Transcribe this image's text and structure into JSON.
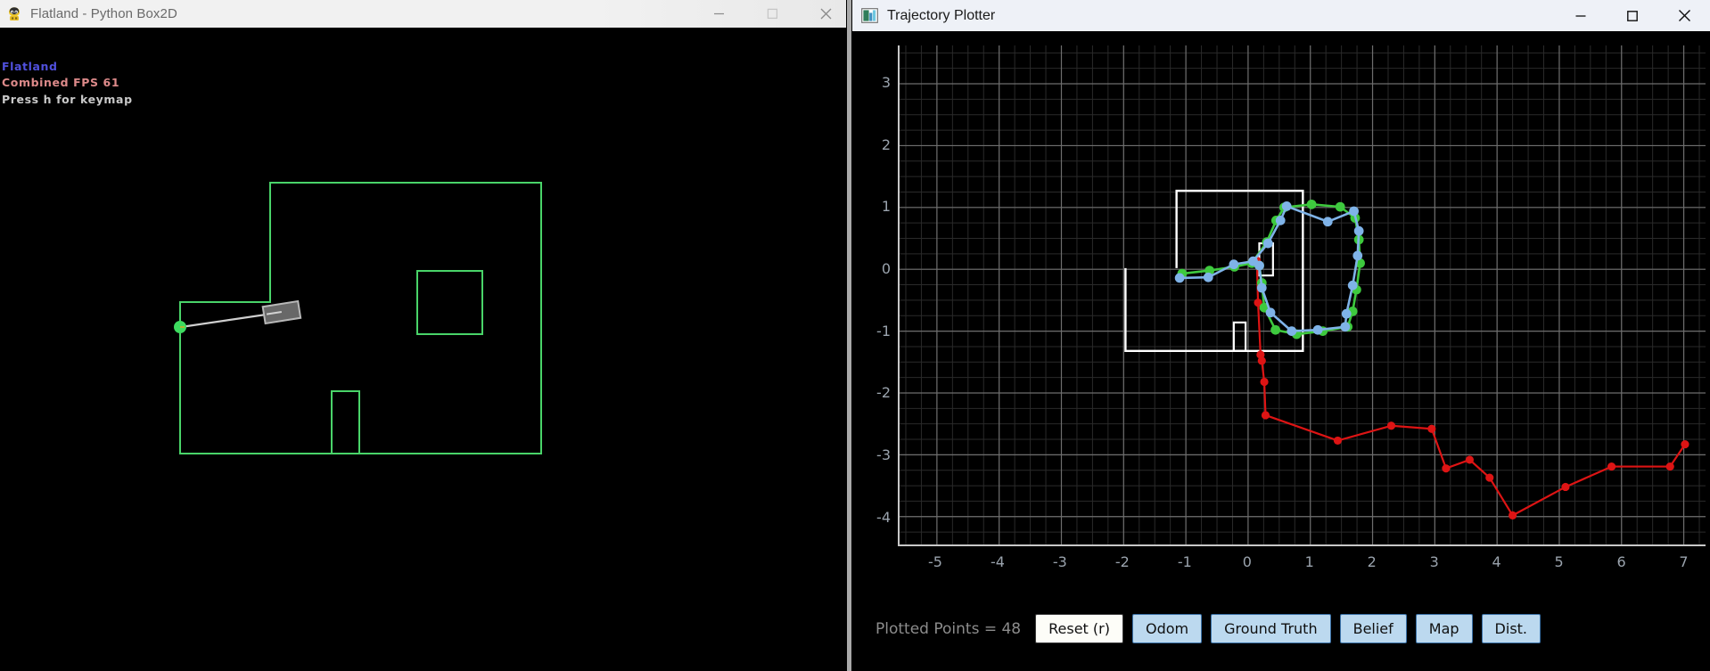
{
  "left_window": {
    "title": "Flatland - Python Box2D",
    "icon": "box2d-app-icon",
    "controls": {
      "minimize": "—",
      "maximize": "☐",
      "close": "✕"
    },
    "overlay": {
      "line1": "Flatland",
      "line2": "Combined FPS 61",
      "line3": "Press h for keymap",
      "color1": "#5050dd",
      "color2": "#dd8a8a",
      "color3": "#c9c9c9"
    },
    "scene": {
      "wall_color": "#49d469",
      "robot_fill": "#686868",
      "robot_outline": "#b8b8b8",
      "goal_color": "#3ddb5f",
      "tether_color": "#cfcfcf"
    }
  },
  "right_window": {
    "title": "Trajectory Plotter",
    "icon": "matplotlib-figure-icon",
    "controls": {
      "minimize": "—",
      "maximize": "☐",
      "close": "✕"
    },
    "toolbar": {
      "status_label": "Plotted Points = 48",
      "buttons": [
        {
          "label": "Reset (r)",
          "name": "reset-button",
          "active": true
        },
        {
          "label": "Odom",
          "name": "odom-button",
          "active": false
        },
        {
          "label": "Ground Truth",
          "name": "ground-truth-button",
          "active": false
        },
        {
          "label": "Belief",
          "name": "belief-button",
          "active": false
        },
        {
          "label": "Map",
          "name": "map-button",
          "active": false
        },
        {
          "label": "Dist.",
          "name": "dist-button",
          "active": false
        }
      ]
    }
  },
  "chart_data": {
    "type": "line",
    "title": "",
    "xlabel": "",
    "ylabel": "",
    "xlim": [
      -5.6,
      7.35
    ],
    "ylim": [
      -4.45,
      3.62
    ],
    "xticks": [
      -5,
      -4,
      -3,
      -2,
      -1,
      0,
      1,
      2,
      3,
      4,
      5,
      6,
      7
    ],
    "yticks": [
      -4,
      -3,
      -2,
      -1,
      0,
      1,
      2,
      3
    ],
    "grid": true,
    "grid_major_color": "#6e6e6e",
    "grid_minor_color": "#2a2a2a",
    "grid_minor_step": 0.25,
    "legend": "none",
    "background": "#000000",
    "series": [
      {
        "name": "Ground Truth",
        "color": "#3ec93e",
        "marker": "o",
        "points": [
          [
            -1.06,
            -0.07
          ],
          [
            -0.62,
            -0.02
          ],
          [
            -0.22,
            0.04
          ],
          [
            0.06,
            0.1
          ],
          [
            0.3,
            0.44
          ],
          [
            0.45,
            0.79
          ],
          [
            0.58,
            1.0
          ],
          [
            1.02,
            1.05
          ],
          [
            1.48,
            1.01
          ],
          [
            1.72,
            0.83
          ],
          [
            1.78,
            0.48
          ],
          [
            1.8,
            0.1
          ],
          [
            1.74,
            -0.33
          ],
          [
            1.68,
            -0.68
          ],
          [
            1.6,
            -0.93
          ],
          [
            1.2,
            -1.0
          ],
          [
            0.78,
            -1.05
          ],
          [
            0.44,
            -0.98
          ],
          [
            0.26,
            -0.62
          ],
          [
            0.22,
            -0.22
          ],
          [
            0.18,
            0.06
          ]
        ]
      },
      {
        "name": "Belief",
        "color": "#7fb3e8",
        "marker": "o",
        "points": [
          [
            -1.1,
            -0.14
          ],
          [
            -0.64,
            -0.13
          ],
          [
            -0.23,
            0.08
          ],
          [
            0.08,
            0.13
          ],
          [
            0.32,
            0.42
          ],
          [
            0.52,
            0.79
          ],
          [
            0.62,
            1.02
          ],
          [
            1.28,
            0.77
          ],
          [
            1.7,
            0.94
          ],
          [
            1.78,
            0.62
          ],
          [
            1.76,
            0.22
          ],
          [
            1.68,
            -0.26
          ],
          [
            1.58,
            -0.72
          ],
          [
            1.56,
            -0.93
          ],
          [
            1.12,
            -0.98
          ],
          [
            0.7,
            -1.0
          ],
          [
            0.36,
            -0.7
          ],
          [
            0.22,
            -0.3
          ],
          [
            0.18,
            0.06
          ]
        ]
      },
      {
        "name": "Odom",
        "color": "#dd1414",
        "marker": "o",
        "points": [
          [
            0.14,
            0.14
          ],
          [
            0.16,
            -0.54
          ],
          [
            0.2,
            -1.38
          ],
          [
            0.22,
            -1.48
          ],
          [
            0.26,
            -1.82
          ],
          [
            0.28,
            -2.36
          ],
          [
            1.44,
            -2.77
          ],
          [
            2.3,
            -2.53
          ],
          [
            2.95,
            -2.58
          ],
          [
            3.18,
            -3.22
          ],
          [
            3.56,
            -3.08
          ],
          [
            3.88,
            -3.37
          ],
          [
            4.25,
            -3.98
          ],
          [
            5.1,
            -3.52
          ],
          [
            5.84,
            -3.19
          ],
          [
            6.78,
            -3.19
          ],
          [
            7.02,
            -2.83
          ]
        ]
      }
    ],
    "map_overlay": {
      "color": "#ffffff",
      "outer_polygon": [
        [
          -1.15,
          0.02
        ],
        [
          -1.15,
          1.27
        ],
        [
          0.88,
          1.27
        ],
        [
          0.88,
          -1.32
        ],
        [
          -1.97,
          -1.32
        ],
        [
          -1.97,
          0.02
        ]
      ],
      "obstacles": [
        {
          "name": "square-obstacle",
          "rect": [
            0.18,
            0.42,
            0.4,
            -0.1
          ]
        },
        {
          "name": "rectangle-obstacle",
          "rect": [
            -0.23,
            -0.86,
            -0.04,
            -1.32
          ]
        }
      ]
    }
  }
}
